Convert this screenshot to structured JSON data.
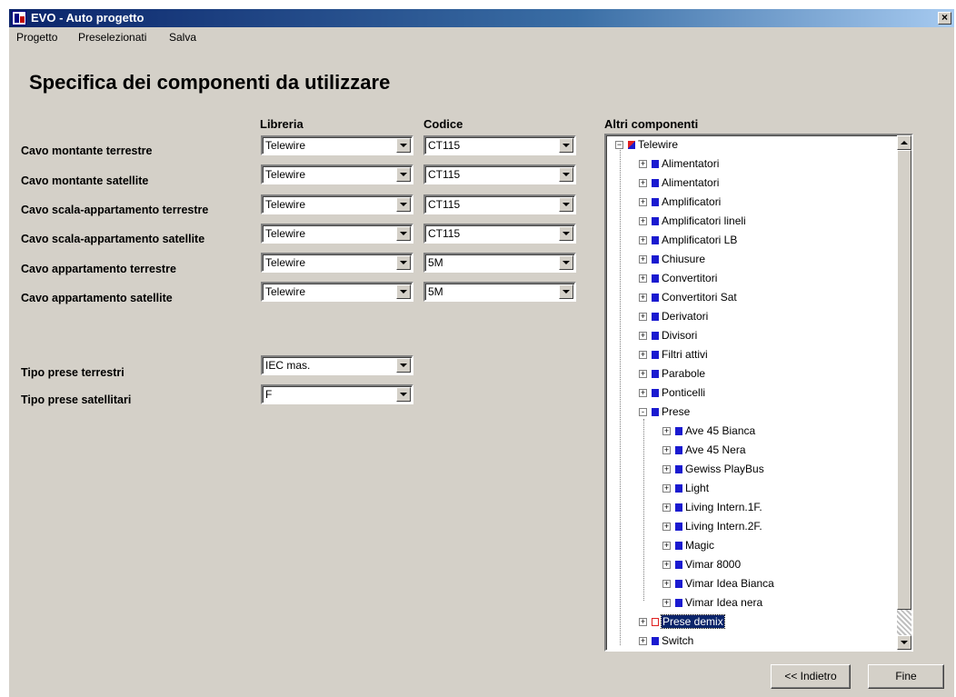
{
  "window": {
    "title": "EVO - Auto progetto"
  },
  "menu": [
    {
      "label": "Progetto"
    },
    {
      "label": "Preselezionati"
    },
    {
      "label": "Salva"
    }
  ],
  "heading": "Specifica dei componenti da utilizzare",
  "columns": {
    "libreria": "Libreria",
    "codice": "Codice",
    "altri": "Altri componenti"
  },
  "cable_rows": [
    {
      "label": "Cavo montante terrestre",
      "libreria": "Telewire",
      "codice": "CT115"
    },
    {
      "label": "Cavo montante satellite",
      "libreria": "Telewire",
      "codice": "CT115"
    },
    {
      "label": "Cavo scala-appartamento terrestre",
      "libreria": "Telewire",
      "codice": "CT115"
    },
    {
      "label": "Cavo scala-appartamento satellite",
      "libreria": "Telewire",
      "codice": "CT115"
    },
    {
      "label": "Cavo appartamento terrestre",
      "libreria": "Telewire",
      "codice": "5M"
    },
    {
      "label": "Cavo appartamento satellite",
      "libreria": "Telewire",
      "codice": "5M"
    }
  ],
  "socket_rows": [
    {
      "label": "Tipo prese terrestri",
      "value": "IEC mas."
    },
    {
      "label": "Tipo prese satellitari",
      "value": "F"
    }
  ],
  "tree": {
    "root": "Telewire",
    "items": [
      {
        "label": "Alimentatori",
        "level": 1,
        "expander": "+"
      },
      {
        "label": "Alimentatori",
        "level": 1,
        "expander": "+"
      },
      {
        "label": "Amplificatori",
        "level": 1,
        "expander": "+"
      },
      {
        "label": "Amplificatori lineli",
        "level": 1,
        "expander": "+"
      },
      {
        "label": "Amplificatori LB",
        "level": 1,
        "expander": "+"
      },
      {
        "label": "Chiusure",
        "level": 1,
        "expander": "+"
      },
      {
        "label": "Convertitori",
        "level": 1,
        "expander": "+"
      },
      {
        "label": "Convertitori Sat",
        "level": 1,
        "expander": "+"
      },
      {
        "label": "Derivatori",
        "level": 1,
        "expander": "+"
      },
      {
        "label": "Divisori",
        "level": 1,
        "expander": "+"
      },
      {
        "label": "Filtri attivi",
        "level": 1,
        "expander": "+"
      },
      {
        "label": "Parabole",
        "level": 1,
        "expander": "+"
      },
      {
        "label": "Ponticelli",
        "level": 1,
        "expander": "+"
      },
      {
        "label": "Prese",
        "level": 1,
        "expander": "-"
      },
      {
        "label": "Ave 45 Bianca",
        "level": 2,
        "expander": "+"
      },
      {
        "label": "Ave 45 Nera",
        "level": 2,
        "expander": "+"
      },
      {
        "label": "Gewiss PlayBus",
        "level": 2,
        "expander": "+"
      },
      {
        "label": "Light",
        "level": 2,
        "expander": "+"
      },
      {
        "label": "Living Intern.1F.",
        "level": 2,
        "expander": "+"
      },
      {
        "label": "Living Intern.2F.",
        "level": 2,
        "expander": "+"
      },
      {
        "label": "Magic",
        "level": 2,
        "expander": "+"
      },
      {
        "label": "Vimar 8000",
        "level": 2,
        "expander": "+"
      },
      {
        "label": "Vimar Idea Bianca",
        "level": 2,
        "expander": "+"
      },
      {
        "label": "Vimar Idea nera",
        "level": 2,
        "expander": "+"
      },
      {
        "label": "Prese demix",
        "level": 1,
        "expander": "+",
        "selected": true
      },
      {
        "label": "Switch",
        "level": 1,
        "expander": "+"
      }
    ]
  },
  "buttons": {
    "back": "<< Indietro",
    "finish": "Fine"
  },
  "colors": {
    "titlebar": "#0a246a",
    "face": "#d4d0c8",
    "node_icon": "#1a1ad0",
    "selection": "#0a246a"
  },
  "icons": {
    "close": "close-icon",
    "app": "evo-app-icon",
    "node": "component-square-icon"
  }
}
